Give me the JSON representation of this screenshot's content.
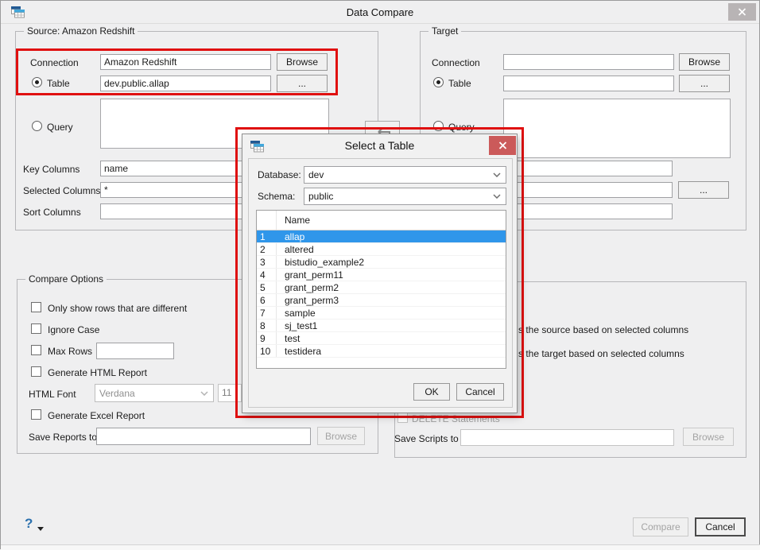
{
  "window": {
    "title": "Data Compare"
  },
  "source": {
    "group_label": "Source: Amazon Redshift",
    "connection_label": "Connection",
    "connection_value": "Amazon Redshift",
    "browse_label": "Browse",
    "table_label": "Table",
    "table_value": "dev.public.allap",
    "more_label": "...",
    "query_label": "Query",
    "key_columns_label": "Key Columns",
    "key_columns_value": "name",
    "selected_columns_label": "Selected Columns",
    "selected_columns_value": "*",
    "sort_columns_label": "Sort Columns",
    "sort_columns_value": ""
  },
  "target": {
    "group_label": "Target",
    "connection_label": "Connection",
    "connection_value": "",
    "browse_label": "Browse",
    "table_label": "Table",
    "table_value": "",
    "more_label": "...",
    "query_label": "Query",
    "key_columns_value": "",
    "selected_columns_value": "",
    "sort_columns_value": ""
  },
  "compare_options": {
    "group_label": "Compare Options",
    "only_show_rows_label": "Only show rows that are different",
    "ignore_case_label": "Ignore Case",
    "max_rows_label": "Max Rows",
    "max_rows_value": "",
    "generate_html_label": "Generate HTML Report",
    "html_font_label": "HTML Font",
    "html_font_value": "Verdana",
    "html_font_size_value": "11",
    "generate_excel_label": "Generate Excel Report",
    "save_reports_label": "Save Reports to",
    "save_reports_value": "",
    "browse_label": "Browse"
  },
  "sync_options": {
    "source_text_fragment": "s the source based on selected columns",
    "target_text_fragment": "s the target based on selected columns",
    "delete_statements_label": "DELETE Statements",
    "save_scripts_label": "Save Scripts to",
    "save_scripts_value": "",
    "browse_label": "Browse"
  },
  "select_table_dialog": {
    "title": "Select a Table",
    "database_label": "Database:",
    "database_value": "dev",
    "schema_label": "Schema:",
    "schema_value": "public",
    "table_header": "Name",
    "tables": [
      {
        "num": "1",
        "name": "allap",
        "selected": true
      },
      {
        "num": "2",
        "name": "altered"
      },
      {
        "num": "3",
        "name": "bistudio_example2"
      },
      {
        "num": "4",
        "name": "grant_perm11"
      },
      {
        "num": "5",
        "name": "grant_perm2"
      },
      {
        "num": "6",
        "name": "grant_perm3"
      },
      {
        "num": "7",
        "name": "sample"
      },
      {
        "num": "8",
        "name": "sj_test1"
      },
      {
        "num": "9",
        "name": "test"
      },
      {
        "num": "10",
        "name": "testidera"
      }
    ],
    "ok_label": "OK",
    "cancel_label": "Cancel"
  },
  "footer": {
    "help_label": "?",
    "compare_label": "Compare",
    "cancel_label": "Cancel"
  },
  "colors": {
    "highlight_red": "#e01010",
    "selection_blue": "#2f96ea",
    "modal_close_red": "#cb5a5a"
  }
}
